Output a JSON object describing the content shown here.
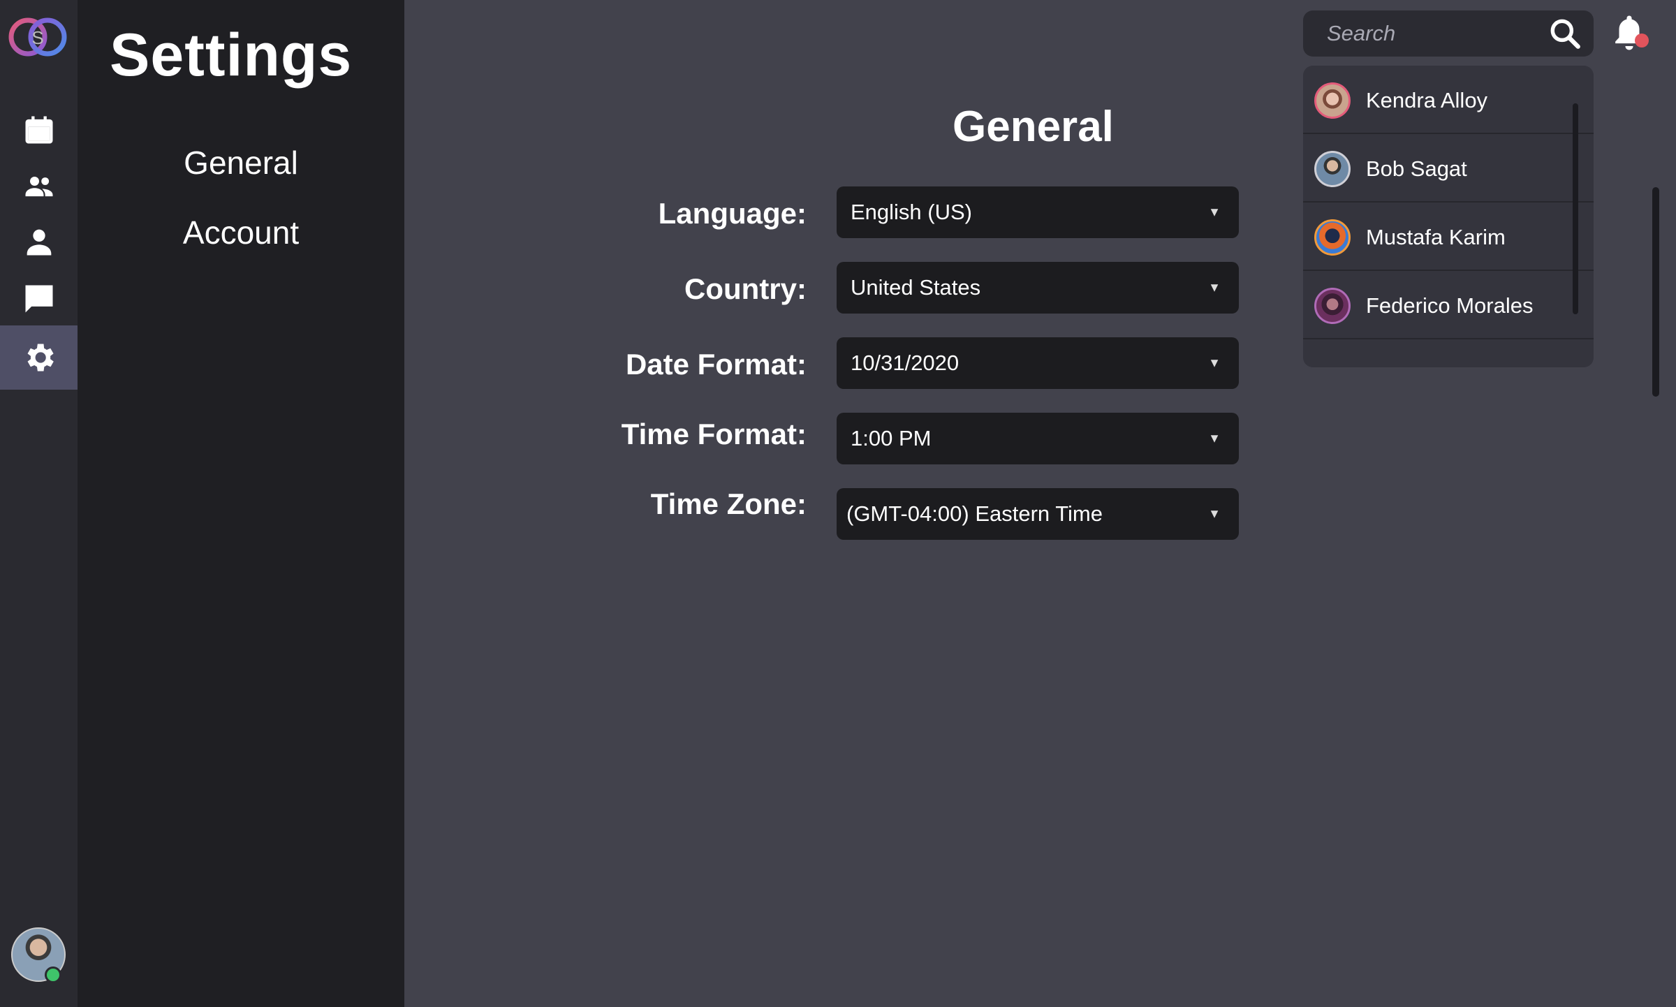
{
  "app": {
    "logo_letter": "S",
    "accent": "#4f4f66",
    "online_color": "#3fc46a",
    "alert_color": "#e2545c"
  },
  "rail": {
    "items": [
      {
        "name": "calendar",
        "icon": "calendar-icon"
      },
      {
        "name": "people",
        "icon": "people-icon"
      },
      {
        "name": "profile",
        "icon": "person-icon"
      },
      {
        "name": "messages",
        "icon": "chat-icon"
      },
      {
        "name": "settings",
        "icon": "gear-icon",
        "active": true
      }
    ]
  },
  "settings": {
    "title": "Settings",
    "nav": [
      "General",
      "Account"
    ]
  },
  "main": {
    "section_title": "General",
    "fields": [
      {
        "label": "Language:",
        "value": "English (US)"
      },
      {
        "label": "Country:",
        "value": "United States"
      },
      {
        "label": "Date Format:",
        "value": "10/31/2020"
      },
      {
        "label": "Time Format:",
        "value": "1:00 PM"
      },
      {
        "label": "Time Zone:",
        "value": "(GMT-04:00) Eastern Time"
      }
    ]
  },
  "search": {
    "placeholder": "Search"
  },
  "contacts": [
    {
      "name": "Kendra Alloy"
    },
    {
      "name": "Bob Sagat"
    },
    {
      "name": "Mustafa Karim"
    },
    {
      "name": "Federico Morales"
    }
  ]
}
